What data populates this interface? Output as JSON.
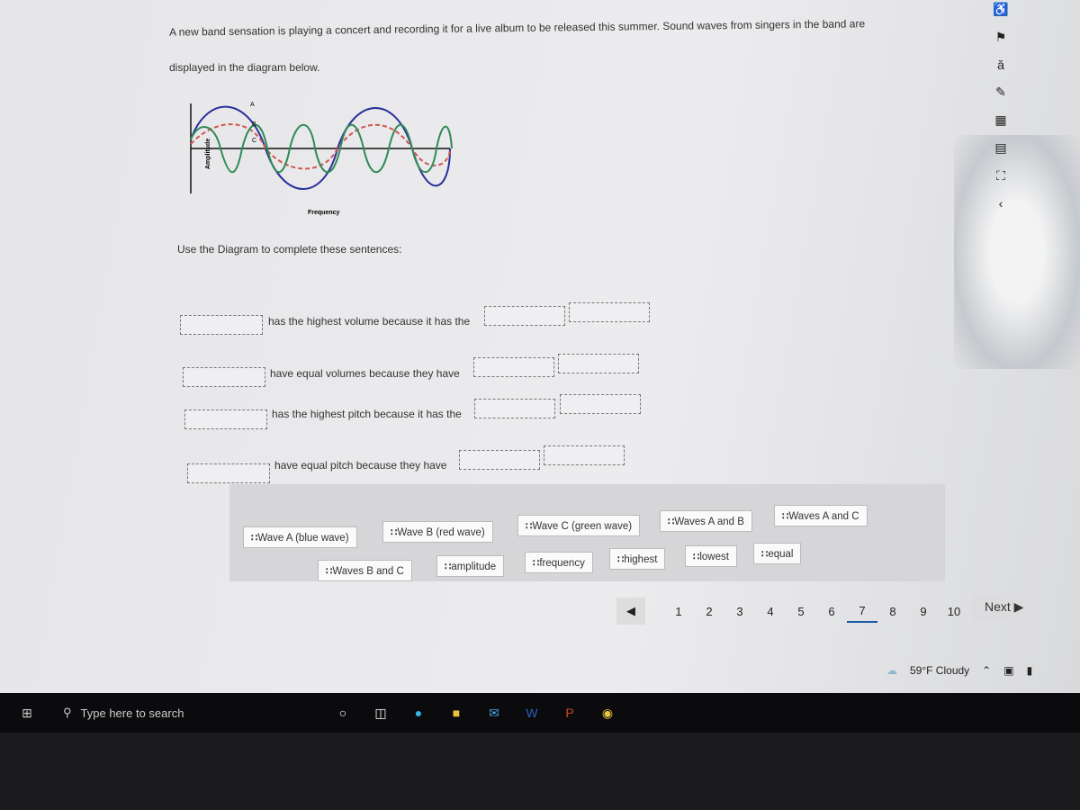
{
  "question": {
    "intro_line1": "A new band sensation is playing a concert and recording it for a live album to be released this summer. Sound waves from singers in the band are",
    "intro_line2": "displayed in the diagram below.",
    "diagram": {
      "y_axis_label": "Amplitude",
      "x_axis_label": "Frequency",
      "wave_labels": [
        "A",
        "B",
        "C"
      ],
      "wave_colors": {
        "A": "#2a2f9a",
        "B": "#d0574f",
        "C": "#2e8b57"
      }
    },
    "instruction": "Use the Diagram to complete these sentences:",
    "sentences": [
      {
        "text": "has the highest volume because it has the"
      },
      {
        "text": "have equal volumes because they have"
      },
      {
        "text": "has the highest pitch because it has the"
      },
      {
        "text": "have equal pitch because they have"
      }
    ]
  },
  "answer_bank": {
    "row1": [
      "Wave A (blue wave)",
      "Wave B (red wave)",
      "Wave C (green wave)",
      "Waves A and B",
      "Waves A and C"
    ],
    "row2": [
      "Waves B and C",
      "amplitude",
      "frequency",
      "highest",
      "lowest",
      "equal"
    ]
  },
  "pager": {
    "pages": [
      "1",
      "2",
      "3",
      "4",
      "5",
      "6",
      "7",
      "8",
      "9",
      "10"
    ],
    "current": "7",
    "next_label": "Next ▶",
    "prev_icon": "◀"
  },
  "side_tools": [
    "accessibility-icon",
    "flag-icon",
    "translate-icon",
    "highlighter-icon",
    "calculator-icon",
    "notes-icon",
    "expand-icon",
    "collapse-icon"
  ],
  "taskbar": {
    "search_placeholder": "Type here to search",
    "weather": "59°F Cloudy"
  }
}
